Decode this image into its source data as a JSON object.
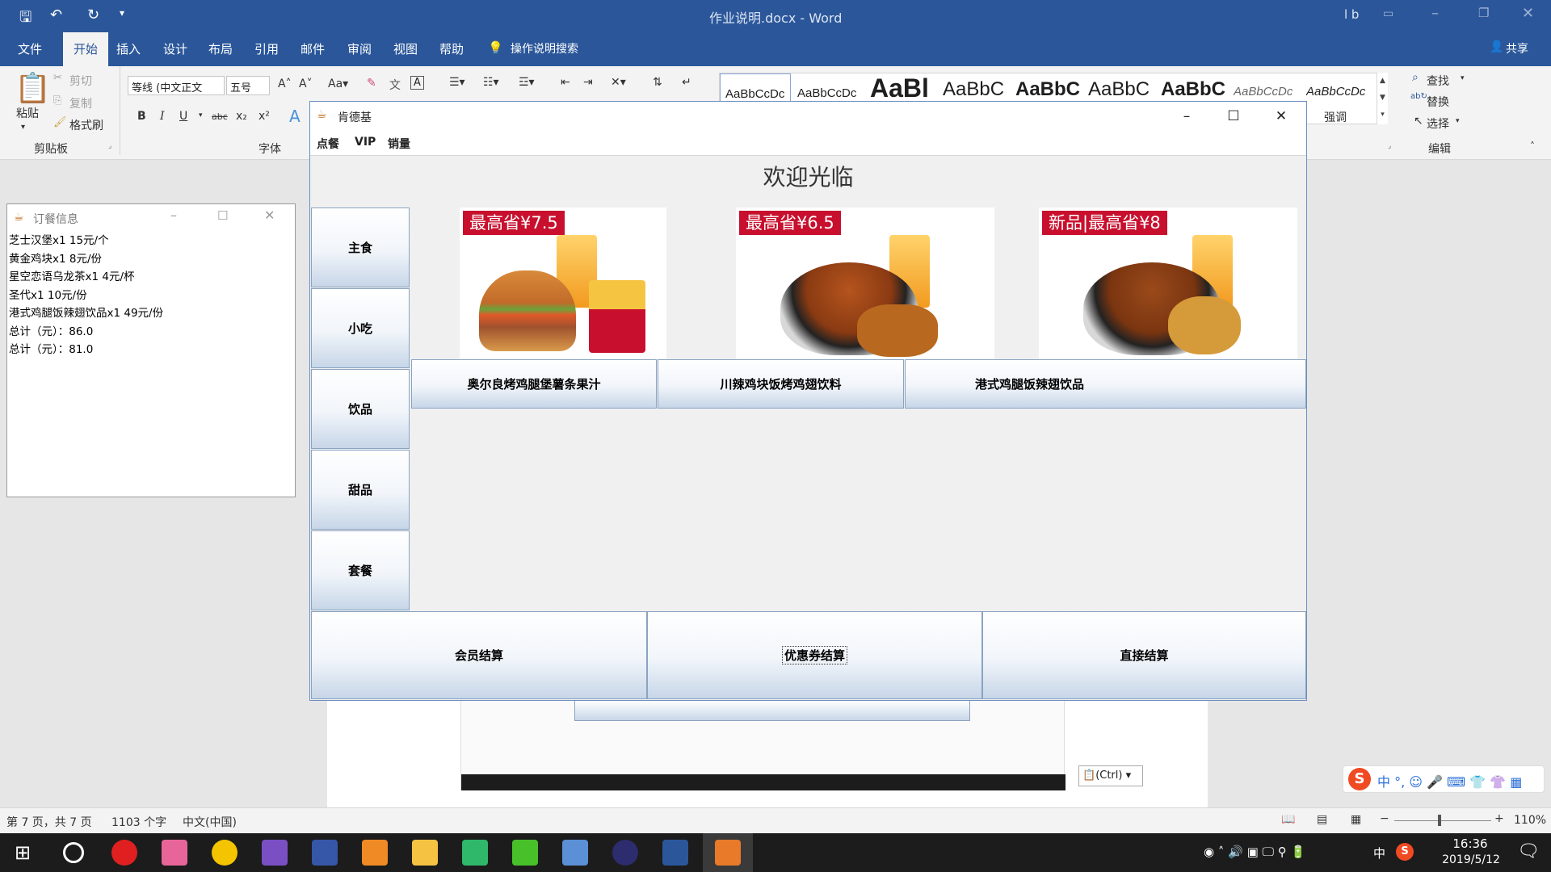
{
  "word": {
    "title": "作业说明.docx - Word",
    "user": "l b",
    "tabs": [
      "文件",
      "开始",
      "插入",
      "设计",
      "布局",
      "引用",
      "邮件",
      "审阅",
      "视图",
      "帮助"
    ],
    "active_tab": "开始",
    "tell_me": "操作说明搜索",
    "share": "共享",
    "clipboard": {
      "paste": "粘贴",
      "cut": "剪切",
      "copy": "复制",
      "format_painter": "格式刷",
      "group": "剪贴板"
    },
    "font": {
      "name": "等线 (中文正文",
      "size": "五号",
      "group": "字体"
    },
    "styles": [
      "AaBbCcDc",
      "AaBbCcDc",
      "AaBl",
      "AaBbC",
      "AaBbC",
      "AaBbC",
      "AaBbC",
      "AaBbCcDc",
      "AaBbCcDc"
    ],
    "style_caption": "强调",
    "editing": {
      "find": "查找",
      "replace": "替换",
      "select": "选择",
      "group": "编辑"
    },
    "ctrl_tag": "(Ctrl)",
    "status": {
      "page": "第 7 页，共 7 页",
      "words": "1103 个字",
      "lang": "中文(中国)",
      "zoom": "110%"
    }
  },
  "order_window": {
    "title": "订餐信息",
    "lines": [
      "芝士汉堡x1   15元/个",
      "黄金鸡块x1   8元/份",
      "星空恋语乌龙茶x1   4元/杯",
      "圣代x1   10元/份",
      "港式鸡腿饭辣翅饮品x1   49元/份",
      "总计（元）：86.0",
      "总计（元）：81.0"
    ]
  },
  "kfc_window": {
    "title": "肯德基",
    "menu": [
      "点餐",
      "VIP",
      "销量"
    ],
    "welcome": "欢迎光临",
    "categories": [
      "主食",
      "小吃",
      "饮品",
      "甜品",
      "套餐"
    ],
    "foods": [
      {
        "name": "奥尔良烤鸡腿堡薯条果汁",
        "promo": "最高省¥7.5"
      },
      {
        "name": "川辣鸡块饭烤鸡翅饮料",
        "promo": "最高省¥6.5"
      },
      {
        "name": "港式鸡腿饭辣翅饮品",
        "promo": "新品|最高省¥8"
      }
    ],
    "payments": [
      "会员结算",
      "优惠券结算",
      "直接结算"
    ]
  },
  "taskbar": {
    "time": "16:36",
    "date": "2019/5/12",
    "ime": "中"
  },
  "colors": {
    "word_blue": "#2b579a",
    "kfc_red": "#c8102e",
    "button_gradient_end": "#c7d6e8"
  }
}
